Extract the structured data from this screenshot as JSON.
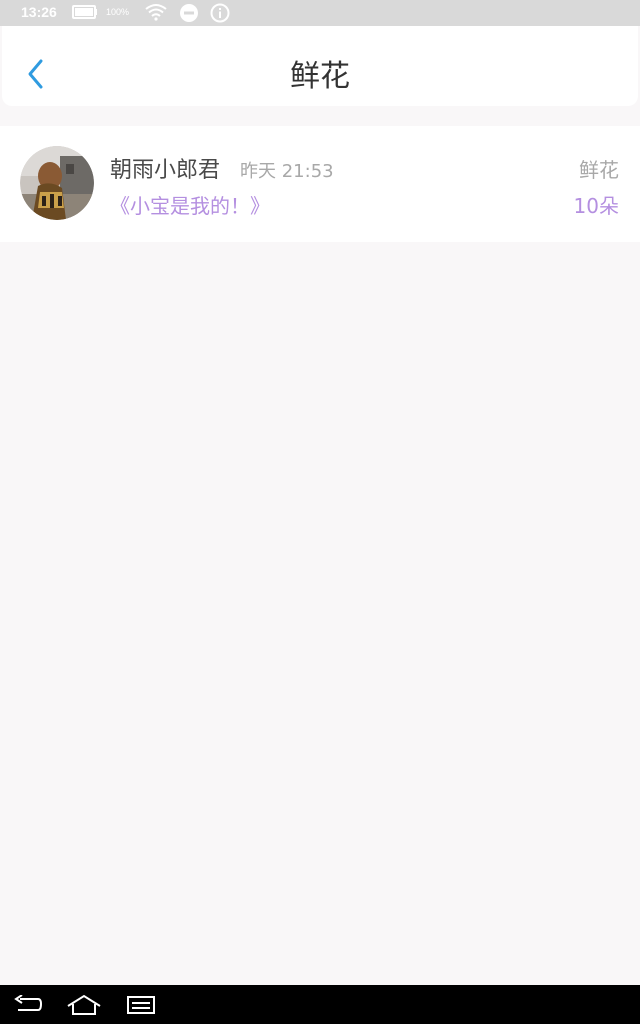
{
  "status_bar": {
    "time": "13:26",
    "battery_percent": "100%",
    "icons": [
      "battery-icon",
      "wifi-icon",
      "do-not-disturb-icon",
      "info-icon"
    ]
  },
  "header": {
    "title": "鲜花",
    "back_icon": "chevron-left-icon",
    "accent_color": "#2f9be0"
  },
  "gifts": [
    {
      "username": "朝雨小郎君",
      "time": "昨天 21:53",
      "message": "《小宝是我的！》",
      "gift_type": "鲜花",
      "gift_count": "10朵"
    }
  ],
  "colors": {
    "background": "#f9f7f8",
    "message_purple": "#b48fe0",
    "muted_gray": "#a8a8a8"
  },
  "nav_bar": {
    "icons": [
      "back-icon",
      "home-icon",
      "recent-apps-icon"
    ]
  }
}
